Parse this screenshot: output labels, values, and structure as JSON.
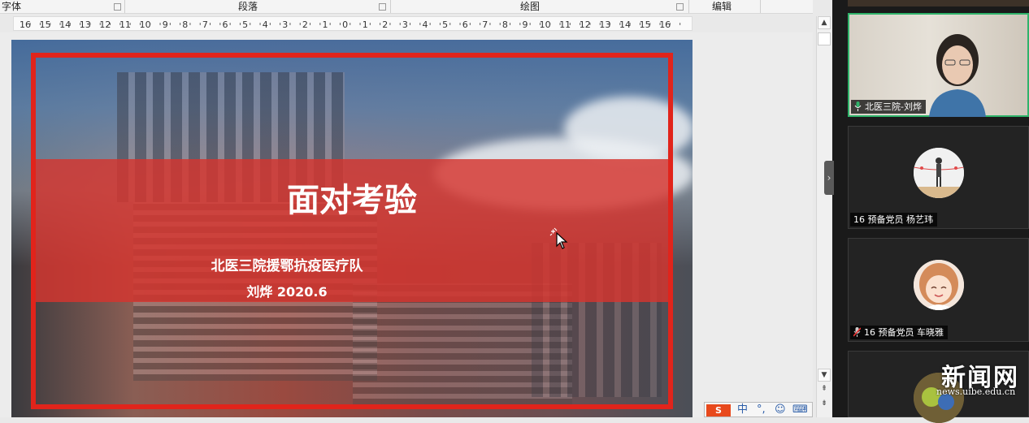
{
  "ribbon": {
    "groups": [
      "字体",
      "段落",
      "绘图",
      "编辑"
    ]
  },
  "ruler": {
    "left_numbers": [
      "16",
      "15",
      "14",
      "13",
      "12",
      "11",
      "10",
      "9",
      "8",
      "7",
      "6",
      "5",
      "4",
      "3",
      "2",
      "1"
    ],
    "center": "1",
    "right_numbers": [
      "1",
      "2",
      "3",
      "4",
      "5",
      "6",
      "7",
      "8",
      "9",
      "10",
      "11",
      "12",
      "13",
      "14",
      "15",
      "16"
    ]
  },
  "slide": {
    "title": "面对考验",
    "subtitle": "北医三院援鄂抗疫医疗队",
    "meta": "刘烨  2020.6"
  },
  "ime": {
    "logo": "S",
    "items": [
      "中",
      "°,",
      "☺",
      "⌨"
    ]
  },
  "participants": [
    {
      "name": "北医三院-刘烨",
      "mic": "on",
      "active": true
    },
    {
      "name": "16 预备党员 杨艺玮",
      "mic": "none"
    },
    {
      "name": "16 预备党员 车晓雅",
      "mic": "muted"
    }
  ],
  "watermark": {
    "title": "新闻网",
    "url": "news.uibe.edu.cn"
  },
  "colors": {
    "slide_red": "#e1241b",
    "active_speaker": "#2fb36a",
    "ime_orange": "#e8491c"
  },
  "icons": [
    "microphone-icon",
    "microphone-muted-icon",
    "chevron-right-icon",
    "scroll-up-icon",
    "scroll-down-icon",
    "cursor-icon"
  ]
}
